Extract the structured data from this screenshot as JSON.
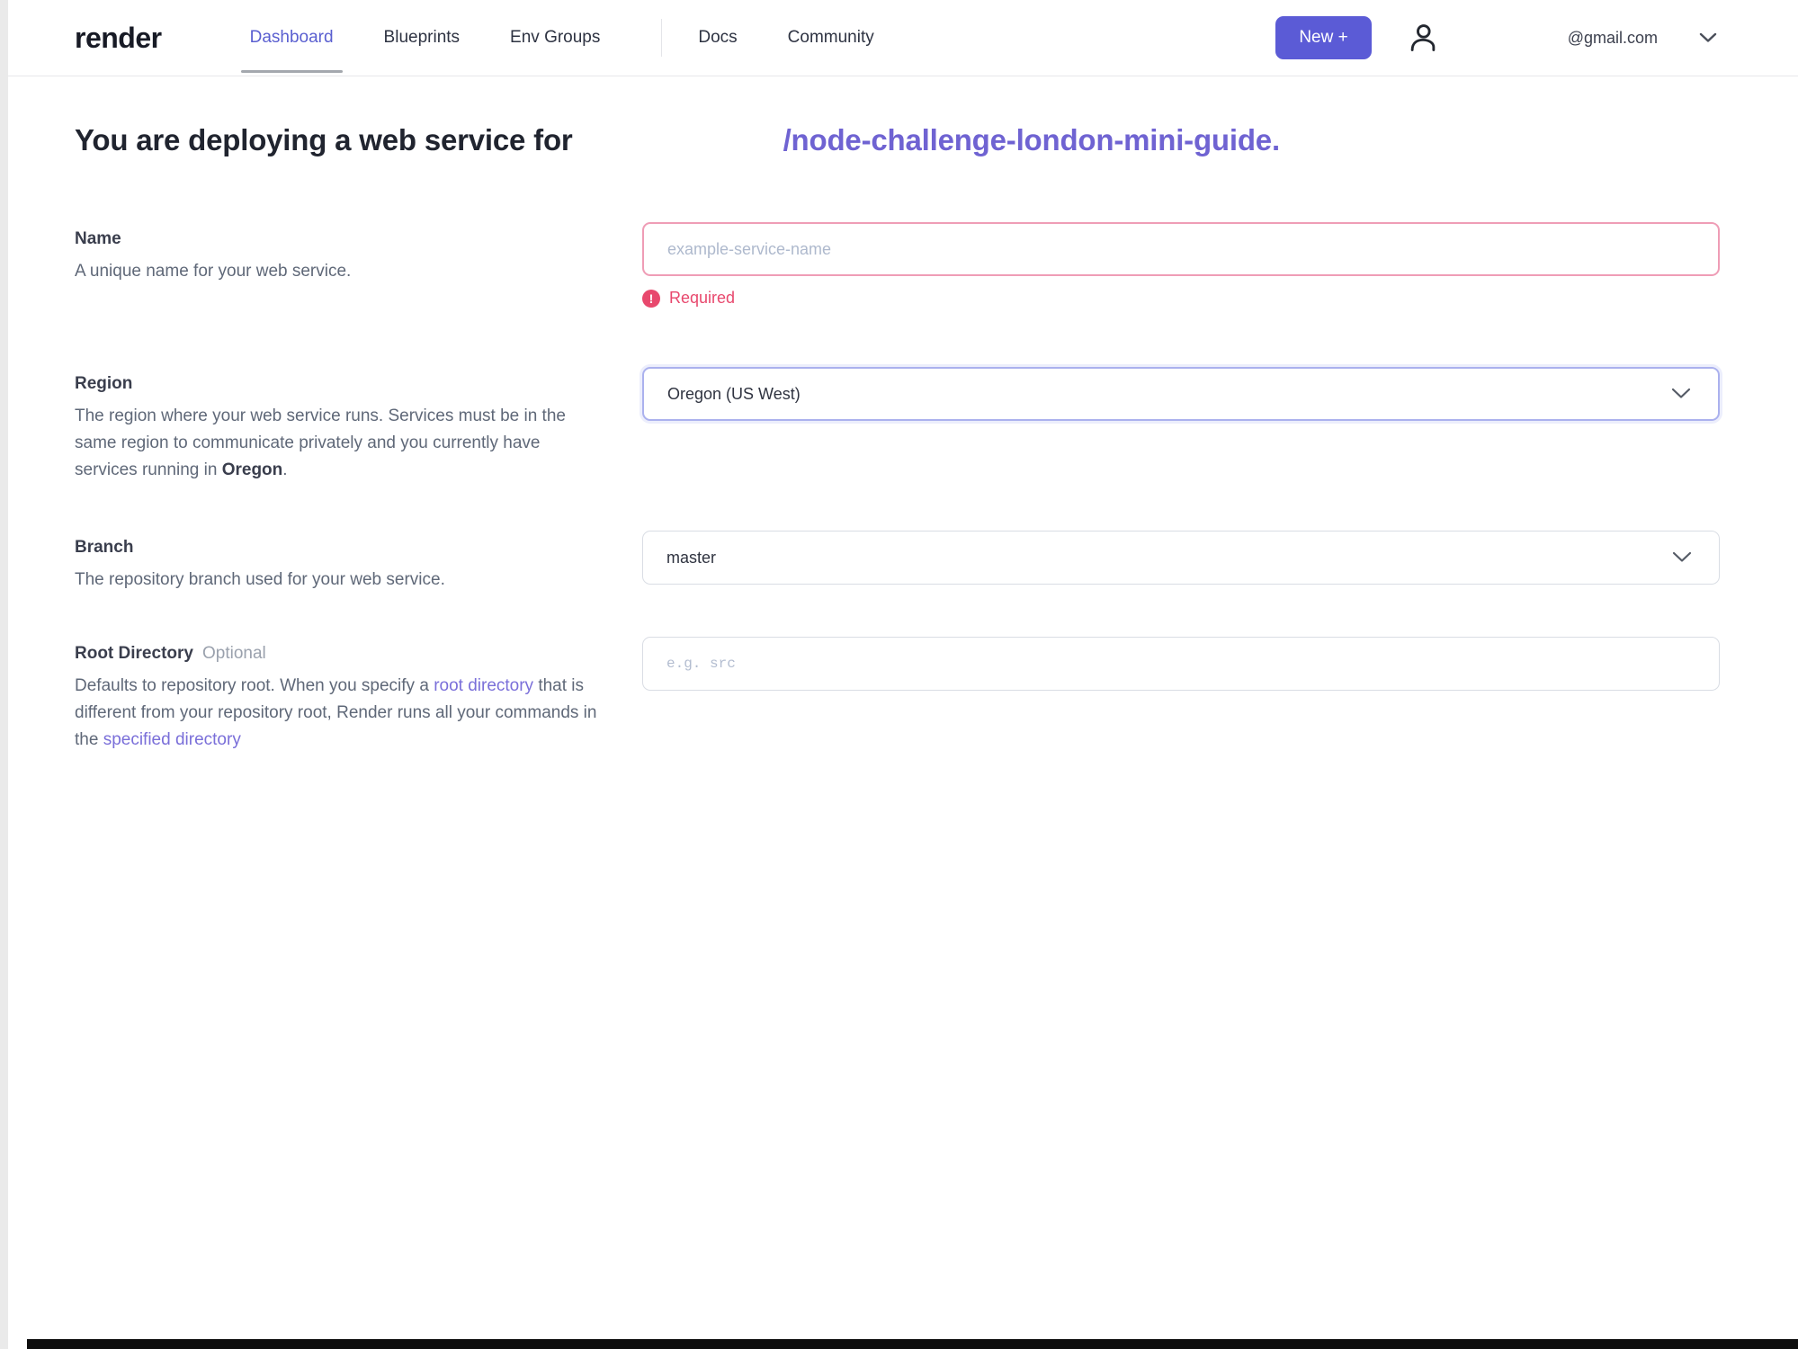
{
  "nav": {
    "logo": "render",
    "items": [
      {
        "label": "Dashboard",
        "active": true
      },
      {
        "label": "Blueprints",
        "active": false
      },
      {
        "label": "Env Groups",
        "active": false
      },
      {
        "label": "Docs",
        "active": false
      },
      {
        "label": "Community",
        "active": false
      }
    ],
    "new_button": "New +",
    "account": {
      "email": "@gmail.com"
    }
  },
  "heading": {
    "prefix": "You are deploying a web service for",
    "repo": "/node-challenge-london-mini-guide."
  },
  "form": {
    "name": {
      "label": "Name",
      "description": "A unique name for your web service.",
      "placeholder": "example-service-name",
      "value": "",
      "error": "Required"
    },
    "region": {
      "label": "Region",
      "desc_1": "The region where your web service runs. Services must be in the same region to communicate privately and you currently have services running in ",
      "desc_bold": "Oregon",
      "desc_2": ".",
      "value": "Oregon (US West)"
    },
    "branch": {
      "label": "Branch",
      "description": "The repository branch used for your web service.",
      "value": "master"
    },
    "root_directory": {
      "label": "Root Directory",
      "optional_tag": "Optional",
      "desc_1": "Defaults to repository root. When you specify a ",
      "link_1": "root directory",
      "desc_2": " that is different from your repository root, Render runs all your commands in the ",
      "link_2": "specified directory",
      "placeholder": "e.g. src",
      "value": ""
    }
  },
  "colors": {
    "accent": "#5b5bd6",
    "active_nav": "#5a5fd0",
    "heading_repo_link": "#6f63d2",
    "description_link": "#7a6fd9",
    "error": "#e8486d",
    "error_border": "#ef9db6",
    "focused_border": "#abb1ee"
  }
}
